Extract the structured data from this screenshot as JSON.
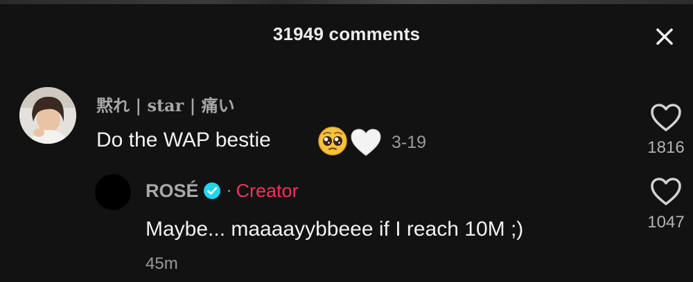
{
  "header": {
    "title": "31949 comments"
  },
  "comment": {
    "username": "黙れ | star | 痛い",
    "text": "Do the WAP bestie",
    "emojis": [
      "pleading-face-emoji",
      "white-heart-emoji"
    ],
    "date": "3-19",
    "like_count": "1816"
  },
  "reply": {
    "author": "ROSÉ",
    "separator": "·",
    "badge": "Creator",
    "text": "Maybe... maaaayybbeee if I reach 10M ;)",
    "time": "45m",
    "like_count": "1047"
  },
  "colors": {
    "background": "#121212",
    "creator_badge": "#f0345a",
    "verified": "#20d5ec"
  }
}
